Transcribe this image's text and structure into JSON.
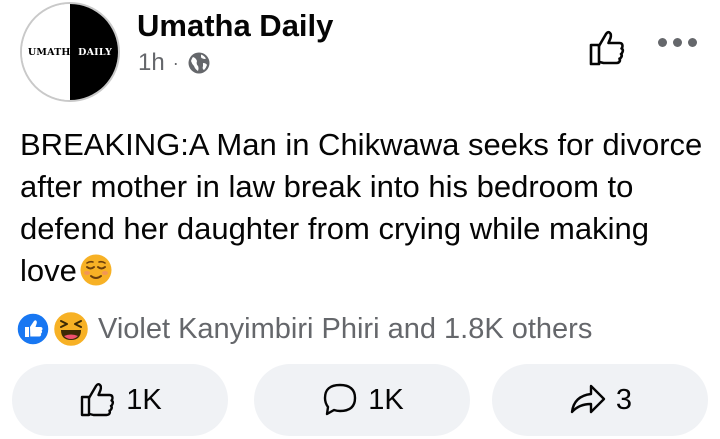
{
  "post": {
    "page_name": "Umatha Daily",
    "avatar_logo": {
      "left": "UMATHA",
      "right": "DAILY"
    },
    "time": "1h",
    "separator": "·",
    "audience_icon": "globe-icon",
    "text": "BREAKING:A Man in Chikwawa seeks for divorce after mother in law break into his bedroom to defend her daughter from crying while making love",
    "text_emoji": "relieved-face-emoji"
  },
  "reactions": {
    "icons": [
      "like-reaction-icon",
      "haha-reaction-icon"
    ],
    "summary": "Violet Kanyimbiri Phiri and 1.8K others"
  },
  "actions": {
    "like_count": "1K",
    "comment_count": "1K",
    "share_count": "3"
  },
  "colors": {
    "text": "#050505",
    "secondary": "#65676b",
    "button_bg": "#f0f2f5",
    "like_blue": "#1877f2",
    "haha_yellow": "#f7b125"
  }
}
